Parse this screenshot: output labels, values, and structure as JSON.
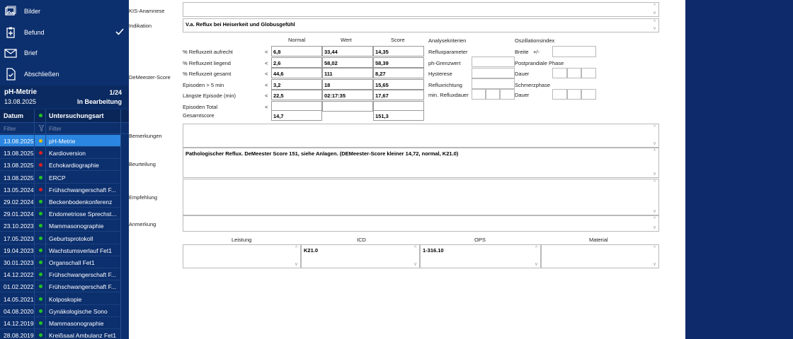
{
  "nav": [
    {
      "label": "Bilder",
      "icon": "images-icon"
    },
    {
      "label": "Befund",
      "icon": "clipboard-icon",
      "checked": true
    },
    {
      "label": "Brief",
      "icon": "envelope-icon"
    },
    {
      "label": "Abschließen",
      "icon": "document-check-icon"
    }
  ],
  "case": {
    "title": "pH-Metrie",
    "count": "1/24",
    "date": "13.08.2025",
    "status": "In Bearbeitung"
  },
  "list": {
    "col_date": "Datum",
    "col_type": "Untersuchungsart",
    "filter_placeholder": "Filter",
    "filter_placeholder2": "Filter",
    "rows": [
      {
        "date": "13.08.2025",
        "type": "pH-Metrie",
        "status_color": "#e3c21a",
        "selected": true
      },
      {
        "date": "13.08.2025",
        "type": "Kardioversion",
        "status_color": "#e02020"
      },
      {
        "date": "13.08.2025",
        "type": "Echokardiographie",
        "status_color": "#e02020"
      },
      {
        "date": "13.08.2025",
        "type": "ERCP",
        "status_color": "#22c322"
      },
      {
        "date": "13.05.2024",
        "type": "Frühschwangerschaft F...",
        "status_color": "#e02020"
      },
      {
        "date": "29.02.2024",
        "type": "Beckenbodenkonferenz",
        "status_color": "#22c322"
      },
      {
        "date": "29.01.2024",
        "type": "Endometriose Sprechst...",
        "status_color": "#22c322"
      },
      {
        "date": "23.10.2023",
        "type": "Mammasonographie",
        "status_color": "#22c322"
      },
      {
        "date": "17.05.2023",
        "type": "Geburtsprotokoll",
        "status_color": "#22c322"
      },
      {
        "date": "19.04.2023",
        "type": "Wachstumsverlauf Fet1",
        "status_color": "#22c322"
      },
      {
        "date": "30.01.2023",
        "type": "Organschall Fet1",
        "status_color": "#22c322"
      },
      {
        "date": "14.12.2022",
        "type": "Frühschwangerschaft F...",
        "status_color": "#22c322"
      },
      {
        "date": "01.02.2022",
        "type": "Frühschwangerschaft F...",
        "status_color": "#22c322"
      },
      {
        "date": "14.05.2021",
        "type": "Kolposkopie",
        "status_color": "#22c322"
      },
      {
        "date": "04.08.2020",
        "type": "Gynäkologische Sono",
        "status_color": "#22c322"
      },
      {
        "date": "14.12.2019",
        "type": "Mammasonographie",
        "status_color": "#22c322"
      },
      {
        "date": "28.08.2019",
        "type": "Kreißsaal Ambulanz Fet1",
        "status_color": "#22c322"
      }
    ]
  },
  "form": {
    "kis_label": "KIS-Anamnese",
    "kis_value": "",
    "indikation_label": "Indikation",
    "indikation_value": "V.a. Reflux bei Heiserkeit und Globusgefühl",
    "demeester_label": "DeMeester-Score",
    "col_normal": "Normal",
    "col_wert": "Wert",
    "col_score": "Score",
    "score_rows": [
      {
        "label": "% Refluxzeit aufrecht",
        "op": "<",
        "normal": "6,8",
        "wert": "33,44",
        "score": "14,35"
      },
      {
        "label": "% Refluxzeit liegend",
        "op": "<",
        "normal": "2,6",
        "wert": "58,02",
        "score": "58,39"
      },
      {
        "label": "% Refluxzeit gesamt",
        "op": "<",
        "normal": "44,6",
        "wert": "111",
        "score": "8,27"
      },
      {
        "label": "Episoden > 5 min",
        "op": "<",
        "normal": "3,2",
        "wert": "18",
        "score": "15,65"
      },
      {
        "label": "Längste Episode (min)",
        "op": "<",
        "normal": "22,5",
        "wert": "02:17:35",
        "score": "17,67"
      },
      {
        "label": "Episoden Total",
        "op": "<",
        "normal": "",
        "wert": "",
        "score": ""
      }
    ],
    "gesamt_label": "Gesamtscore",
    "gesamt_normal": "14,7",
    "gesamt_score": "151,3",
    "analyse_head": "Analysekriterien",
    "analyse_items": [
      "Refluxparameter",
      "ph-Grenzwert",
      "Hysterese",
      "Refluxrichtung",
      "min. Refluxdauer"
    ],
    "oszill_head": "Oszillationsindex",
    "breite_label": "Breite",
    "breite_pm": "+/-",
    "post_phase": "Postprandiale Phase",
    "dauer_label": "Dauer",
    "schmerz_phase": "Schmerzphase",
    "dauer_label2": "Dauer",
    "bemerkungen_label": "Bemerkungen",
    "beurteilung_label": "Beurteilung",
    "beurteilung_value": "Pathologischer Reflux. DeMeester Score 151, siehe Anlagen. (DEMeester-Score kleiner 14,72, normal, K21.0)",
    "empfehlung_label": "Empfehlung",
    "anmerkung_label": "Anmerkung",
    "leistung_head": "Leistung",
    "icd_head": "ICD",
    "ops_head": "OPS",
    "material_head": "Material",
    "icd_value": "K21.0",
    "ops_value": "1-316.10"
  },
  "colors": {
    "sidebar": "#0c2f6e",
    "selected": "#2a86e0",
    "background": "#0f2a6b"
  }
}
